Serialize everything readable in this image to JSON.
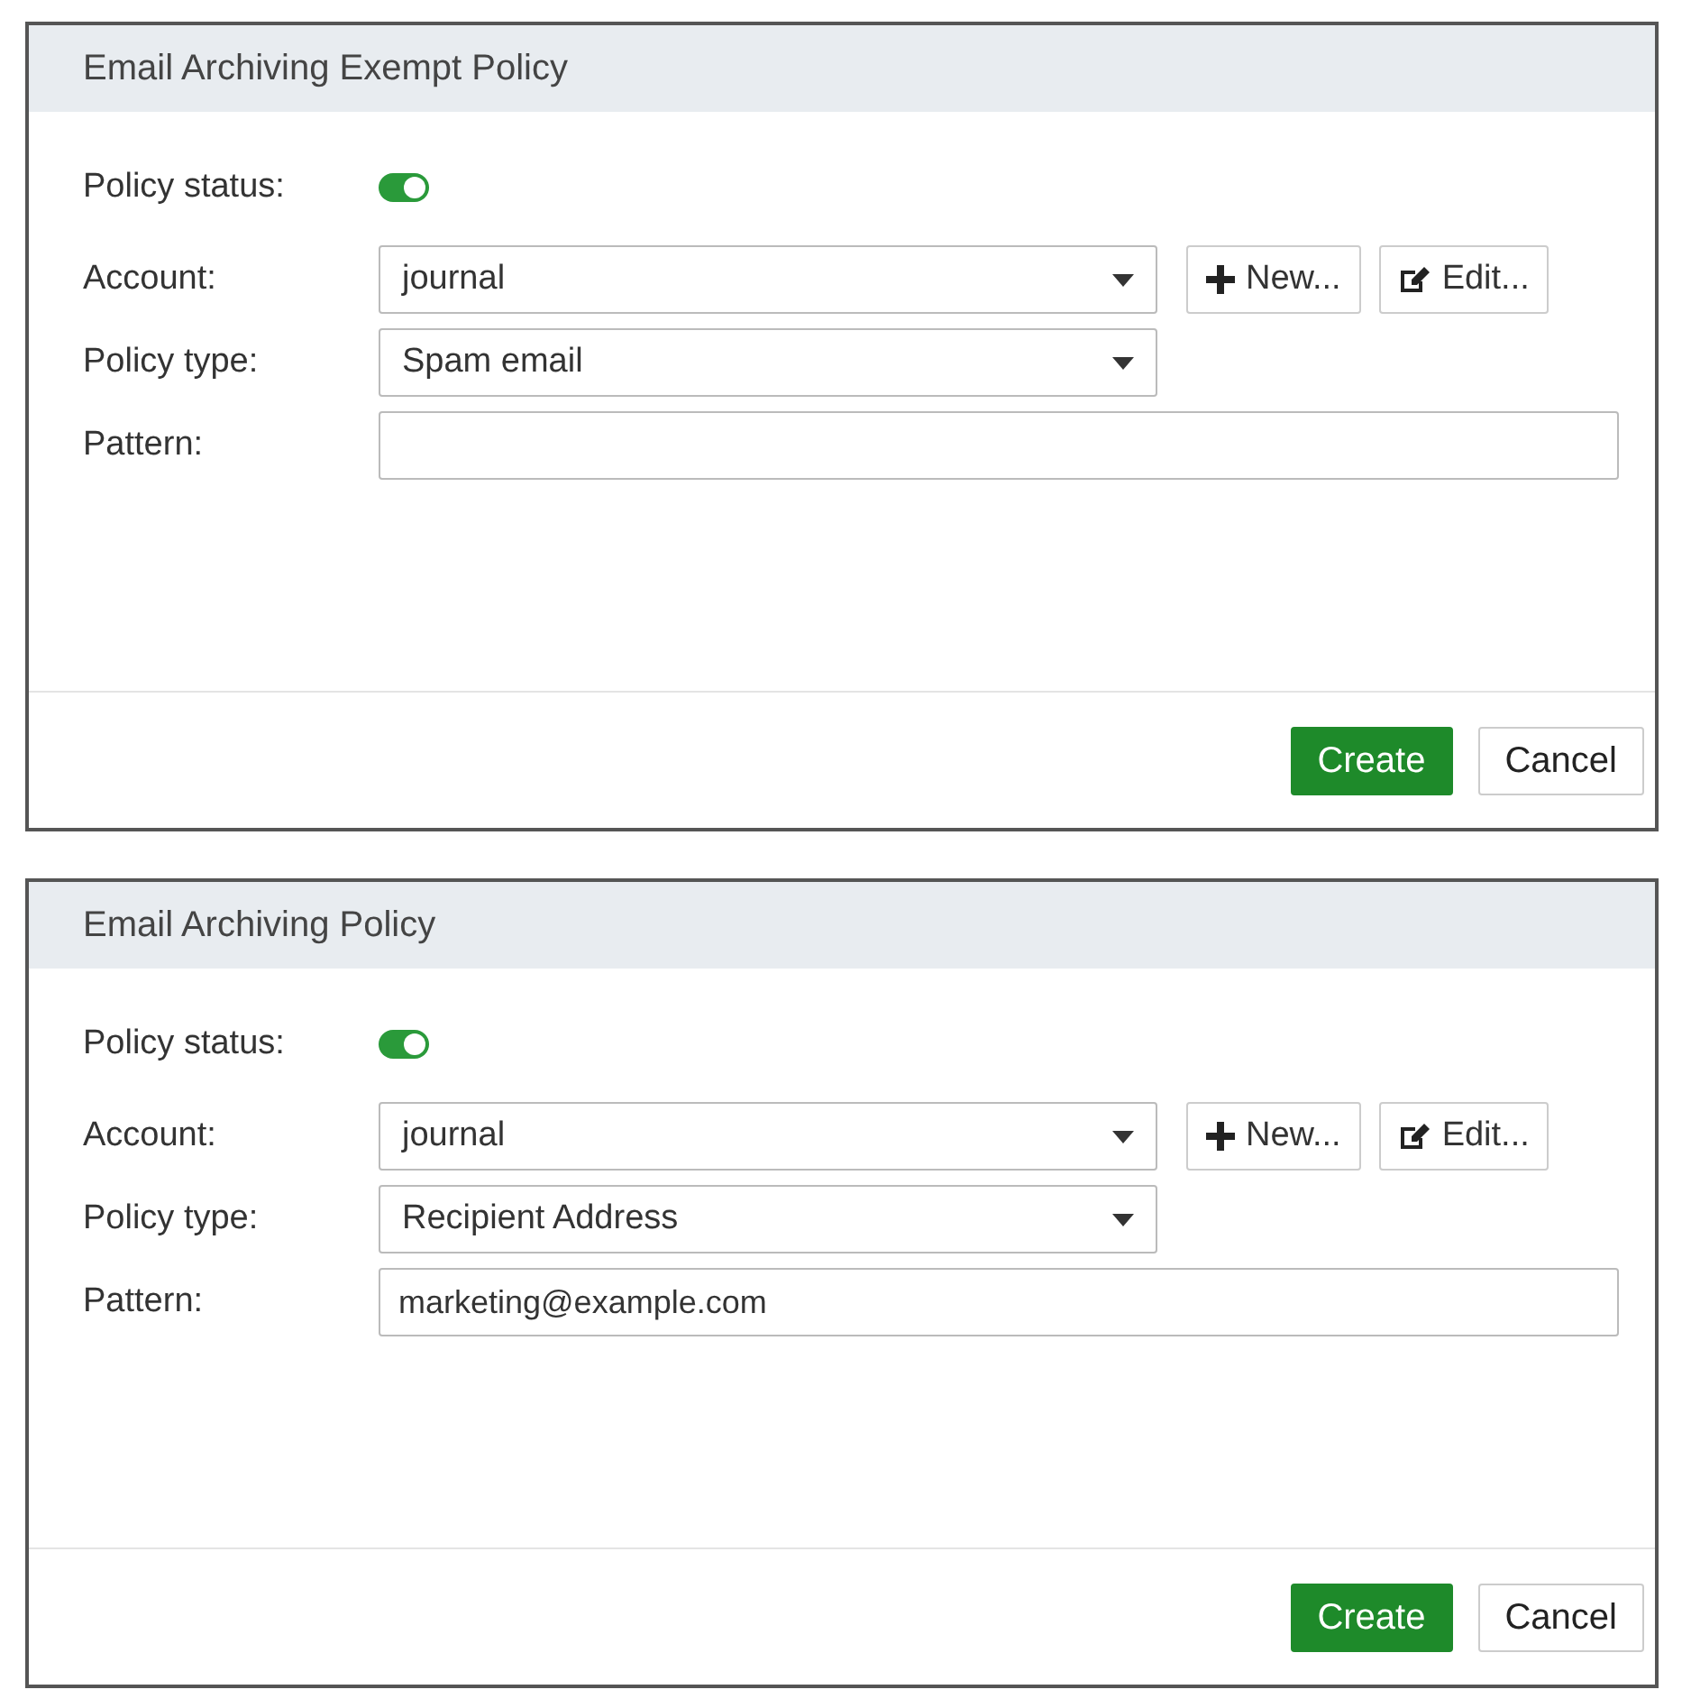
{
  "dialogs": [
    {
      "title": "Email Archiving Exempt Policy",
      "status": {
        "label": "Policy status:",
        "on": true
      },
      "fields": [
        {
          "kind": "select",
          "label": "Account:",
          "value": "journal",
          "actions": [
            {
              "kind": "add",
              "label": "New..."
            },
            {
              "kind": "edit",
              "label": "Edit..."
            }
          ]
        },
        {
          "kind": "select",
          "label": "Policy type:",
          "value": "Spam email"
        },
        {
          "kind": "text",
          "label": "Pattern:"
        }
      ],
      "buttons": [
        {
          "label": "Create",
          "primary": true
        },
        {
          "label": "Cancel",
          "primary": false
        }
      ]
    },
    {
      "title": "Email Archiving Policy",
      "status": {
        "label": "Policy status:",
        "on": true
      },
      "fields": [
        {
          "kind": "select",
          "label": "Account:",
          "value": "journal",
          "actions": [
            {
              "kind": "add",
              "label": "New..."
            },
            {
              "kind": "edit",
              "label": "Edit..."
            }
          ]
        },
        {
          "kind": "select",
          "label": "Policy type:",
          "value": "Recipient Address"
        },
        {
          "kind": "text",
          "label": "Pattern:",
          "value": "marketing@example.com"
        }
      ],
      "buttons": [
        {
          "label": "Create",
          "primary": true
        },
        {
          "label": "Cancel",
          "primary": false
        }
      ]
    }
  ]
}
